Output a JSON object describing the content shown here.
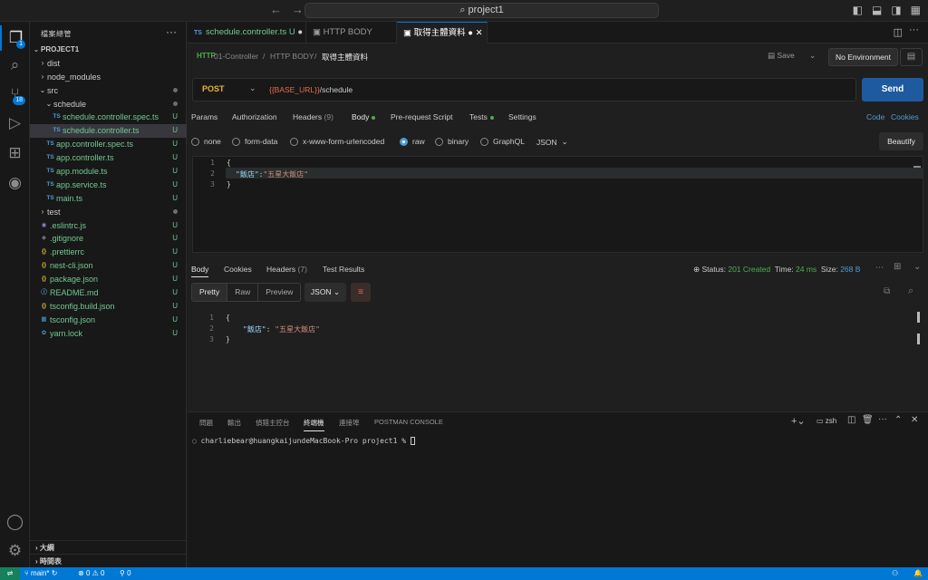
{
  "window": {
    "title": "project1",
    "nav_back": "←",
    "nav_fwd": "→"
  },
  "activity": {
    "explorer_badge": "1",
    "scm_badge": "18"
  },
  "explorer": {
    "header": "檔案總管",
    "project": "PROJECT1",
    "items": [
      {
        "label": "dist",
        "type": "folder",
        "status": ""
      },
      {
        "label": "node_modules",
        "type": "folder",
        "status": ""
      },
      {
        "label": "src",
        "type": "folder-open",
        "status": "dot"
      },
      {
        "label": "schedule",
        "type": "folder-open",
        "status": "dot"
      },
      {
        "label": "schedule.controller.spec.ts",
        "type": "ts",
        "status": "U"
      },
      {
        "label": "schedule.controller.ts",
        "type": "ts",
        "status": "U"
      },
      {
        "label": "app.controller.spec.ts",
        "type": "ts",
        "status": "U"
      },
      {
        "label": "app.controller.ts",
        "type": "ts",
        "status": "U"
      },
      {
        "label": "app.module.ts",
        "type": "ts",
        "status": "U"
      },
      {
        "label": "app.service.ts",
        "type": "ts",
        "status": "U"
      },
      {
        "label": "main.ts",
        "type": "ts",
        "status": "U"
      },
      {
        "label": "test",
        "type": "folder",
        "status": "dot"
      },
      {
        "label": ".eslintrc.js",
        "type": "eslint",
        "status": "U"
      },
      {
        "label": ".gitignore",
        "type": "git",
        "status": "U"
      },
      {
        "label": ".prettierrc",
        "type": "json",
        "status": "U"
      },
      {
        "label": "nest-cli.json",
        "type": "json",
        "status": "U"
      },
      {
        "label": "package.json",
        "type": "json",
        "status": "U"
      },
      {
        "label": "README.md",
        "type": "info",
        "status": "U"
      },
      {
        "label": "tsconfig.build.json",
        "type": "json",
        "status": "U"
      },
      {
        "label": "tsconfig.json",
        "type": "tsconfig",
        "status": "U"
      },
      {
        "label": "yarn.lock",
        "type": "yarn",
        "status": "U"
      }
    ],
    "outline": "大綱",
    "timeline": "時間表"
  },
  "tabs": [
    {
      "label": "schedule.controller.ts",
      "suffix": "U",
      "icon": "TS"
    },
    {
      "label": "HTTP BODY",
      "icon": "http"
    },
    {
      "label": "取得主體資料",
      "icon": "http"
    }
  ],
  "postman": {
    "breadcrumb": [
      "01-Controller",
      "HTTP BODY",
      "取得主體資料"
    ],
    "save": "Save",
    "environment": "No Environment",
    "method": "POST",
    "url_var": "{{BASE_URL}}",
    "url_path": "/schedule",
    "send": "Send",
    "request_tabs": [
      "Params",
      "Authorization",
      "Headers",
      "(9)",
      "Body",
      "Pre-request Script",
      "Tests",
      "Settings"
    ],
    "code_link": "Code",
    "cookies_link": "Cookies",
    "body_types": [
      "none",
      "form-data",
      "x-www-form-urlencoded",
      "raw",
      "binary",
      "GraphQL"
    ],
    "body_format": "JSON",
    "beautify": "Beautify",
    "request_body": {
      "line1": "{",
      "key": "\"飯店\"",
      "colon": ":",
      "value": "\"五星大飯店\"",
      "line3": "}"
    },
    "line_numbers": [
      "1",
      "2",
      "3"
    ],
    "response_tabs": [
      "Body",
      "Cookies",
      "Headers",
      "(7)",
      "Test Results"
    ],
    "status_label": "Status:",
    "status_value": "201 Created",
    "time_label": "Time:",
    "time_value": "24 ms",
    "size_label": "Size:",
    "size_value": "268 B",
    "view_modes": [
      "Pretty",
      "Raw",
      "Preview"
    ],
    "response_format": "JSON",
    "response_body": {
      "line1": "{",
      "key": "\"飯店\"",
      "colon": ": ",
      "value": "\"五星大飯店\"",
      "line3": "}"
    }
  },
  "panel": {
    "tabs": [
      "問題",
      "輸出",
      "偵錯主控台",
      "終端機",
      "連接埠",
      "POSTMAN CONSOLE"
    ],
    "shell": "zsh",
    "prompt": "charliebear@huangkaijundeMacBook-Pro project1 % "
  },
  "statusbar": {
    "branch": "main*",
    "errors": "0",
    "warnings": "0",
    "ports": "0"
  },
  "colors": {
    "accent": "#0078d4",
    "send": "#1e5aa0",
    "post": "#e8b339",
    "success": "#4caf50",
    "untracked": "#73c991"
  }
}
